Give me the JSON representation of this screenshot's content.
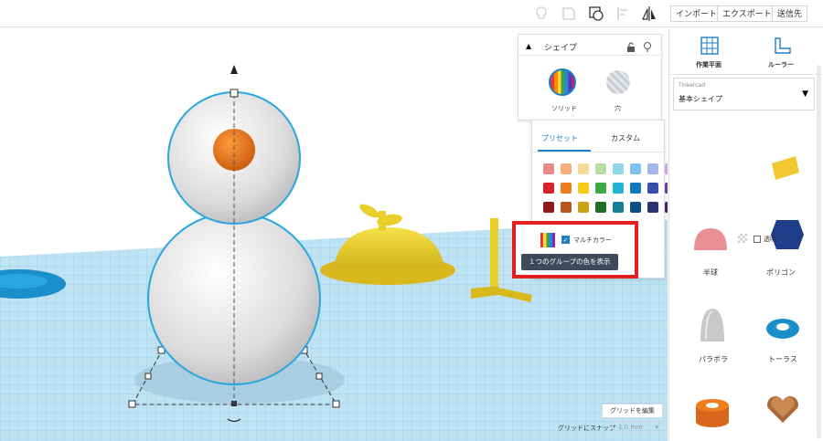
{
  "toolbar": {
    "import_label": "インポート",
    "export_label": "エクスポート",
    "send_label": "送信先"
  },
  "sidebar": {
    "workplane_label": "作業平面",
    "ruler_label": "ルーラー",
    "library_source": "Tinkercad",
    "library_selected": "基本シェイプ",
    "shapes": [
      {
        "label": "半球"
      },
      {
        "label": "ポリゴン"
      },
      {
        "label": "パラボラ"
      },
      {
        "label": "トーラス"
      }
    ]
  },
  "shape_panel": {
    "title": "シェイプ",
    "solid_label": "ソリッド",
    "hole_label": "穴"
  },
  "color_panel": {
    "tab_preset": "プリセット",
    "tab_custom": "カスタム",
    "multicolor_label": "マルチカラー",
    "tooltip": "１つのグループの色を表示",
    "transparent_label": "透明",
    "swatches": [
      [
        "#e98a8a",
        "#f4b07a",
        "#f5d999",
        "#b8dca8",
        "#8fd6e6",
        "#7fc4ec",
        "#a3b6ea",
        "#c9a7e6",
        "#e7a6cc",
        "#d8b07e",
        "#ffffff",
        "#a9acb0"
      ],
      [
        "#d9232b",
        "#ef7d1e",
        "#f4cc1a",
        "#3aa845",
        "#22b2d3",
        "#1277c1",
        "#3a4ea8",
        "#6b3aa2",
        "#d72a8a",
        "#a36a2f",
        "#dfe1e4",
        "#6f7378"
      ],
      [
        "#8f1a1e",
        "#b8551a",
        "#c8a214",
        "#1f6e2c",
        "#157d96",
        "#0d4e86",
        "#273470",
        "#4a2272",
        "#941c5e",
        "#6e4420",
        "#c4c7cb",
        "#3a3d41"
      ]
    ]
  },
  "grid": {
    "edit_grid_label": "グリッドを編集",
    "snap_label": "グリッドにスナップ",
    "snap_value": "1.0 mm"
  },
  "colors": {
    "highlight": "#e51f1f",
    "accent_blue": "#1f7fc4",
    "tooltip_bg": "#3c4a5a"
  }
}
